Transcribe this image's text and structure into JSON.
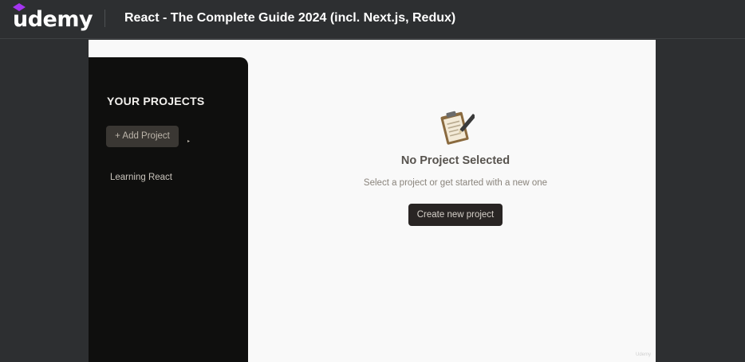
{
  "header": {
    "logo_text": "udemy",
    "course_title": "React - The Complete Guide 2024 (incl. Next.js, Redux)"
  },
  "sidebar": {
    "heading": "YOUR PROJECTS",
    "add_button_label": "+ Add Project",
    "projects": [
      {
        "label": "Learning React"
      }
    ]
  },
  "main": {
    "icon": "clipboard-pen-icon",
    "title": "No Project Selected",
    "subtitle": "Select a project or get started with a new one",
    "create_button_label": "Create new project"
  },
  "video": {
    "watermark": "Udemy"
  },
  "colors": {
    "brand": "#a435f0",
    "topbar_bg": "#2d2f31",
    "sidebar_bg": "#0f0f0e",
    "button_dark": "#292524"
  }
}
